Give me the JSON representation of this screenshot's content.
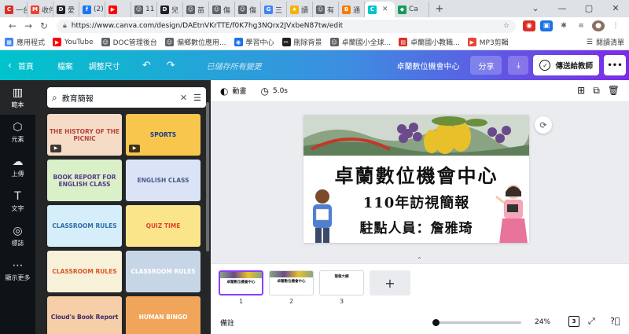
{
  "browser": {
    "tabs": [
      {
        "label": "一台",
        "color": "#d93025",
        "mark": "C"
      },
      {
        "label": "收件",
        "color": "#ea4335",
        "mark": "M"
      },
      {
        "label": "愛",
        "color": "#202124",
        "mark": "D"
      },
      {
        "label": "(2)",
        "color": "#1877f2",
        "mark": "f"
      },
      {
        "label": "",
        "color": "#ff0000",
        "mark": "▶"
      },
      {
        "label": "11",
        "color": "#5f6368",
        "mark": "☺"
      },
      {
        "label": "兒",
        "color": "#202124",
        "mark": "D"
      },
      {
        "label": "苗",
        "color": "#5f6368",
        "mark": "☺"
      },
      {
        "label": "傷",
        "color": "#5f6368",
        "mark": "☺"
      },
      {
        "label": "傷",
        "color": "#5f6368",
        "mark": "☺"
      },
      {
        "label": "三",
        "color": "#4285f4",
        "mark": "G"
      },
      {
        "label": "讀",
        "color": "#f4b400",
        "mark": "★"
      },
      {
        "label": "有",
        "color": "#5f6368",
        "mark": "☺"
      },
      {
        "label": "通",
        "color": "#f57c00",
        "mark": "B"
      }
    ],
    "active_tab": {
      "label": "",
      "color": "#00c4cc",
      "mark": "C"
    },
    "last_tab": {
      "label": "Ca",
      "color": "#0f9d58",
      "mark": "◆"
    },
    "url": "https://www.canva.com/design/DAEtnVKrTTE/f0K7hg3NQrx2JVxbeN87tw/edit",
    "bookmarks": [
      {
        "label": "應用程式",
        "color": "#4285f4",
        "mark": "▦"
      },
      {
        "label": "YouTube",
        "color": "#ff0000",
        "mark": "▶"
      },
      {
        "label": "DOC管理後台",
        "color": "#5f6368",
        "mark": "☺"
      },
      {
        "label": "偏鄉數位應用...",
        "color": "#5f6368",
        "mark": "☺"
      },
      {
        "label": "學習中心",
        "color": "#1a73e8",
        "mark": "◉"
      },
      {
        "label": "刪除背景",
        "color": "#202124",
        "mark": "✂"
      },
      {
        "label": "卓蘭國小全球...",
        "color": "#5f6368",
        "mark": "☺"
      },
      {
        "label": "卓蘭國小教職...",
        "color": "#d93025",
        "mark": "▤"
      },
      {
        "label": "MP3剪輯",
        "color": "#ea4335",
        "mark": "▶"
      }
    ],
    "reading_list": "閱讀清單"
  },
  "header": {
    "home": "首頁",
    "file": "檔案",
    "resize": "調整尺寸",
    "saved": "已儲存所有變更",
    "design_title": "卓蘭數位機會中心",
    "share": "分享",
    "send": "傳送給教師"
  },
  "rail": [
    {
      "icon": "▥",
      "label": "範本",
      "name": "rail-templates"
    },
    {
      "icon": "⬡",
      "label": "元素",
      "name": "rail-elements"
    },
    {
      "icon": "☁",
      "label": "上傳",
      "name": "rail-uploads"
    },
    {
      "icon": "T",
      "label": "文字",
      "name": "rail-text"
    },
    {
      "icon": "◎",
      "label": "標誌",
      "name": "rail-logos"
    },
    {
      "icon": "⋯",
      "label": "顯示更多",
      "name": "rail-more"
    }
  ],
  "search": {
    "value": "教育簡報"
  },
  "templates": [
    {
      "text": "THE HISTORY OF THE PICNIC",
      "bg": "#f6dcc7",
      "fg": "#b5443a",
      "video": true
    },
    {
      "text": "SPORTS",
      "bg": "#f9c64d",
      "fg": "#1f3a8a",
      "video": true
    },
    {
      "text": "BOOK REPORT FOR ENGLISH CLASS",
      "bg": "#d9f0c8",
      "fg": "#5b3a8a",
      "video": false
    },
    {
      "text": "ENGLISH CLASS",
      "bg": "#dbe4f7",
      "fg": "#4a5a8a",
      "video": false
    },
    {
      "text": "CLASSROOM RULES",
      "bg": "#d6eef9",
      "fg": "#2f6ea8",
      "video": false
    },
    {
      "text": "QUIZ TIME",
      "bg": "#fbe58b",
      "fg": "#e2432f",
      "video": false
    },
    {
      "text": "CLASSROOM RULES",
      "bg": "#f7f1d9",
      "fg": "#d9572b",
      "video": false
    },
    {
      "text": "CLASSROOM RULES",
      "bg": "#c7d6e6",
      "fg": "#ffffff",
      "video": false
    },
    {
      "text": "Cloud's Book Report",
      "bg": "#f6cfa8",
      "fg": "#3b2a6b",
      "video": false
    },
    {
      "text": "HUMAN BINGO",
      "bg": "#f0a55a",
      "fg": "#ffffff",
      "video": false
    }
  ],
  "toolbar": {
    "animate": "動畫",
    "duration": "5.0s"
  },
  "slide": {
    "line1": "卓蘭數位機會中心",
    "line2": "110年訪視簡報",
    "line3": "駐點人員：詹雅琦"
  },
  "pages": [
    {
      "num": "1",
      "text": "卓蘭數位機會中心"
    },
    {
      "num": "2",
      "text": "卓蘭數位機會中心"
    },
    {
      "num": "3",
      "text": "簡報大綱"
    }
  ],
  "bottom": {
    "notes": "備註",
    "zoom": "24%",
    "page_count": "3"
  },
  "colors": {
    "accent": "#8b3dff",
    "rail": "#0e1318",
    "panel": "#252627"
  }
}
